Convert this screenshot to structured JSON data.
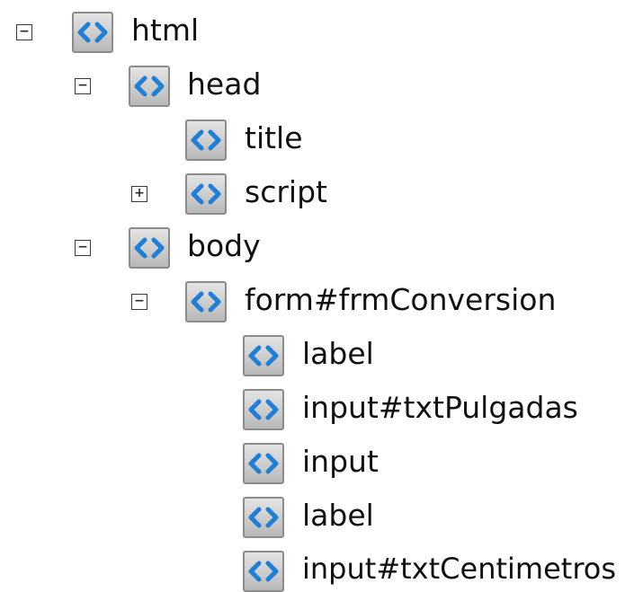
{
  "tree": {
    "nodes": [
      {
        "id": "html",
        "label": "html",
        "toggle": "⊟",
        "toggle_glyph": "−"
      },
      {
        "id": "head",
        "label": "head",
        "toggle": "⊟",
        "toggle_glyph": "−"
      },
      {
        "id": "title",
        "label": "title"
      },
      {
        "id": "script",
        "label": "script",
        "toggle": "⊞",
        "toggle_glyph": "+"
      },
      {
        "id": "body",
        "label": "body",
        "toggle": "⊟",
        "toggle_glyph": "−"
      },
      {
        "id": "form",
        "label": "form#frmConversion",
        "toggle": "⊟",
        "toggle_glyph": "−"
      },
      {
        "id": "label1",
        "label": "label"
      },
      {
        "id": "input-pulgadas",
        "label": "input#txtPulgadas"
      },
      {
        "id": "input",
        "label": "input"
      },
      {
        "id": "label2",
        "label": "label"
      },
      {
        "id": "input-centimetros",
        "label": "input#txtCentimetros"
      }
    ]
  },
  "icon": {
    "name": "html-element-icon",
    "glyph_color": "#1f7fd6"
  }
}
